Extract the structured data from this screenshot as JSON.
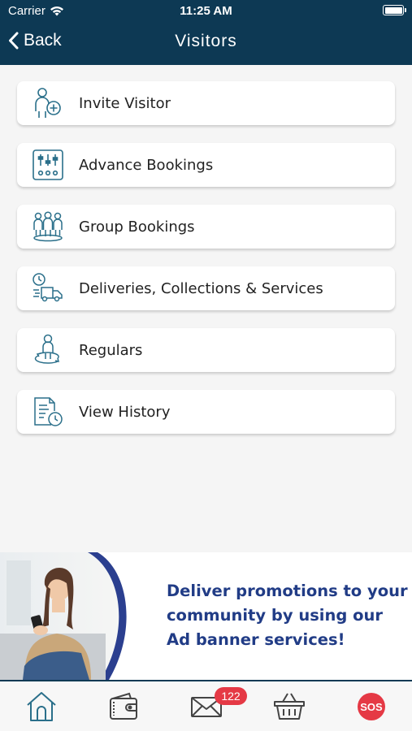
{
  "status_bar": {
    "carrier": "Carrier",
    "time": "11:25 AM"
  },
  "nav": {
    "back_label": "Back",
    "title": "Visitors"
  },
  "menu": [
    {
      "label": "Invite Visitor",
      "icon": "invite-visitor-icon"
    },
    {
      "label": "Advance Bookings",
      "icon": "advance-bookings-icon"
    },
    {
      "label": "Group Bookings",
      "icon": "group-bookings-icon"
    },
    {
      "label": "Deliveries, Collections & Services",
      "icon": "delivery-truck-icon"
    },
    {
      "label": "Regulars",
      "icon": "regular-visitor-icon"
    },
    {
      "label": "View History",
      "icon": "history-icon"
    }
  ],
  "ad_banner": {
    "text": "Deliver promotions to your community by using our Ad banner services!"
  },
  "tab_bar": {
    "items": [
      "home-icon",
      "wallet-icon",
      "mail-icon",
      "basket-icon",
      "sos-icon"
    ],
    "mail_badge": "122",
    "sos_label": "SOS"
  },
  "colors": {
    "header": "#0d3954",
    "icon_teal": "#2a6f8a",
    "ad_text": "#213c86",
    "badge": "#e53945"
  }
}
